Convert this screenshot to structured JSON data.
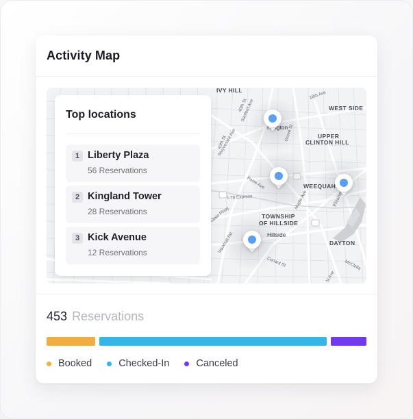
{
  "card": {
    "title": "Activity Map"
  },
  "map": {
    "area_labels": {
      "ivy_hill": "IVY HILL",
      "west_side": "WEST SIDE",
      "upper_clinton_hill_1": "UPPER",
      "upper_clinton_hill_2": "CLINTON HILL",
      "weequahic": "WEEQUAHIC",
      "township_1": "TOWNSHIP",
      "township_2": "OF HILLSIDE",
      "dayton": "DAYTON",
      "hillside": "Hillside",
      "irvington": "rvington"
    },
    "street_labels": {
      "s18th": "18th Ave",
      "stuyvesant": "Stuyvesant Ave",
      "sanford": "Sanford Ave",
      "s40th": "40th St",
      "s49th": "49th St",
      "grove": "Grove St",
      "paine": "Paine Ave",
      "i78": "I-78 Express",
      "state_pkwy": "State Pkwy",
      "maple": "Maple Ave",
      "vauxhall": "Vauxhall Rd",
      "conant": "Conant St",
      "elizabeth": "Elizabeth Ave",
      "mcclellan": "McClella",
      "n_ave": "N Ave"
    },
    "highway_shields": [
      "78",
      "22",
      "78"
    ],
    "pins": [
      {
        "name": "Irvington"
      },
      {
        "name": "Kingland"
      },
      {
        "name": "Weequahic"
      },
      {
        "name": "Hillside"
      }
    ]
  },
  "panel": {
    "title": "Top locations",
    "items": [
      {
        "rank": "1",
        "name": "Liberty Plaza",
        "sub": "56 Reservations"
      },
      {
        "rank": "2",
        "name": "Kingland Tower",
        "sub": "28 Reservations"
      },
      {
        "rank": "3",
        "name": "Kick Avenue",
        "sub": "12 Reservations"
      }
    ]
  },
  "summary": {
    "count": "453",
    "unit": "Reservations"
  },
  "status_bar": {
    "segments": [
      {
        "name": "Booked",
        "fraction": 0.156,
        "color": "#f0ad43"
      },
      {
        "name": "Checked-In",
        "fraction": 0.729,
        "color": "#35b6e6"
      },
      {
        "name": "Canceled",
        "fraction": 0.115,
        "color": "#7139f0"
      }
    ]
  },
  "legend": {
    "booked": "Booked",
    "checked_in": "Checked-In",
    "canceled": "Canceled"
  },
  "colors": {
    "booked": "#f0ad43",
    "checked_in": "#35b6e6",
    "canceled": "#7139f0",
    "pin": "#5b9ff2"
  }
}
